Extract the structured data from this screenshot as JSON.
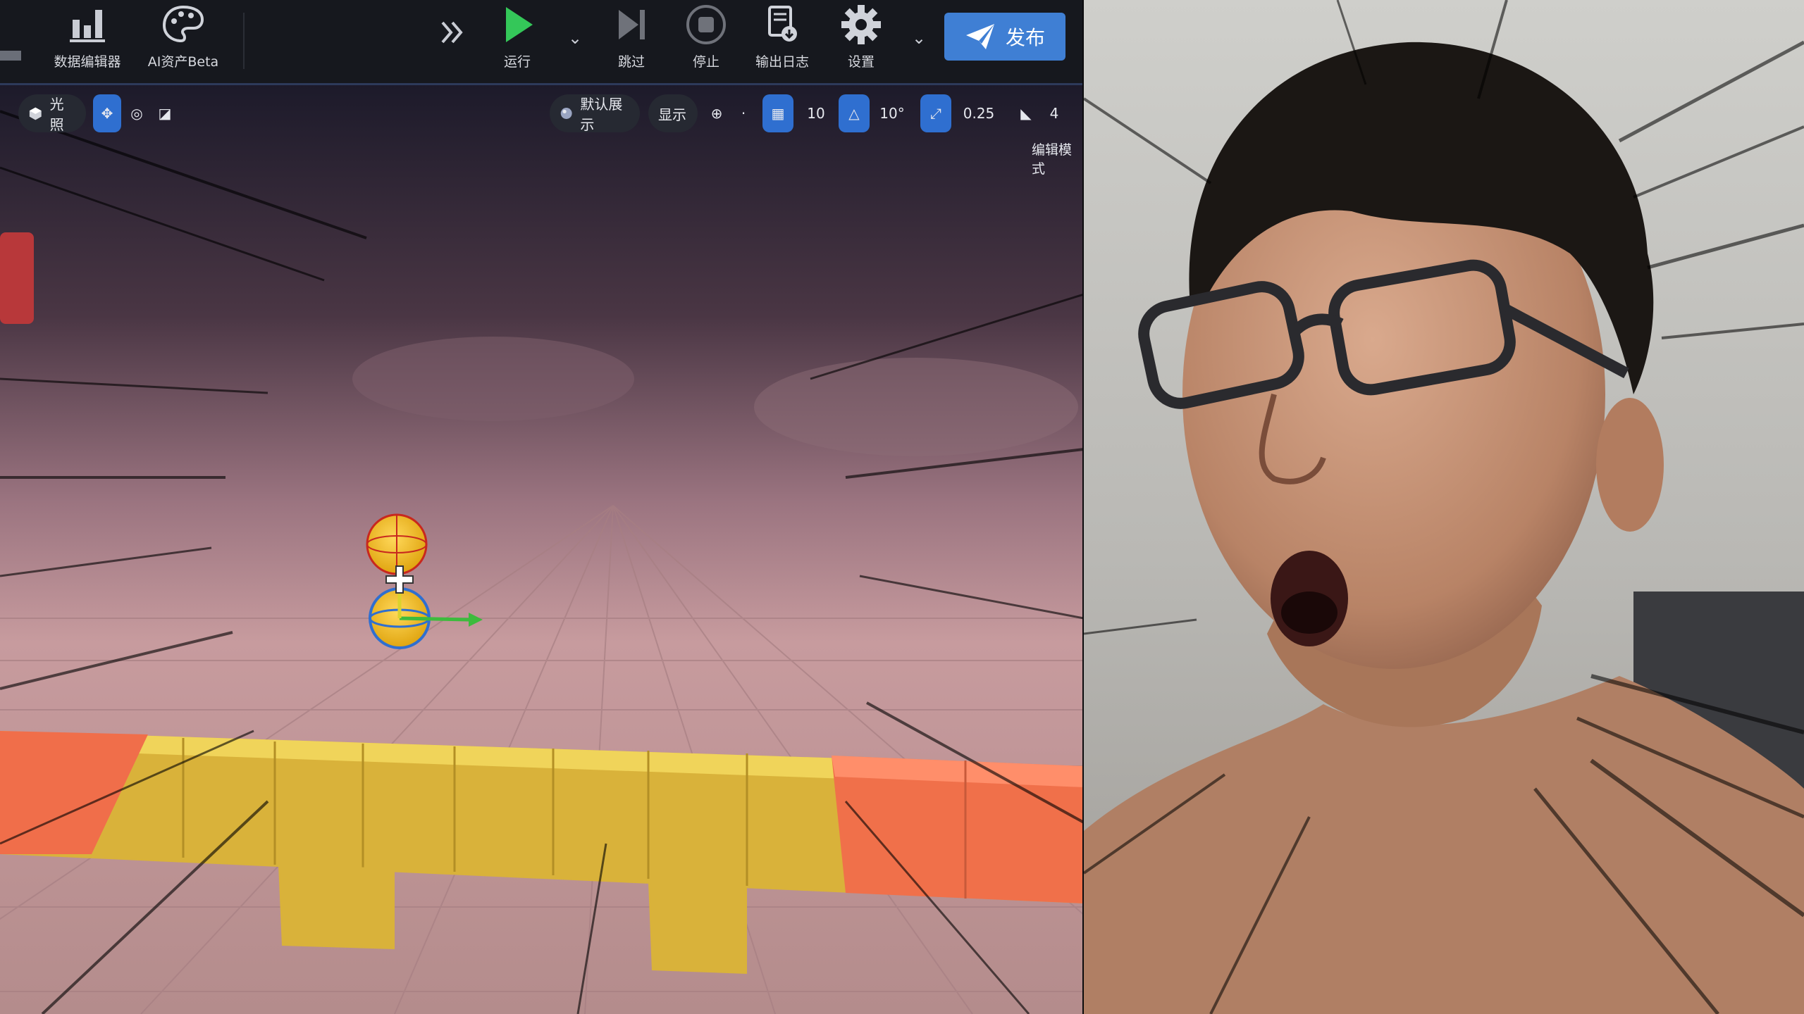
{
  "toolbar": {
    "data_editor_label": "数据编辑器",
    "ai_assets_label": "AI资产Beta",
    "run_label": "运行",
    "skip_label": "跳过",
    "stop_label": "停止",
    "log_label": "输出日志",
    "settings_label": "设置",
    "publish_label": "发布"
  },
  "viewport_toolbar": {
    "lighting_label": "光照",
    "default_view_label": "默认展示",
    "display_label": "显示",
    "grid_snap_value": "10",
    "rotate_snap_value": "10°",
    "scale_snap_value": "0.25",
    "camera_speed_value": "4",
    "mode_label": "编辑模式"
  },
  "colors": {
    "accent_blue": "#2f6fd0",
    "publish_blue": "#3f7fd4",
    "run_green": "#34c759",
    "block_yellow": "#e6c63c",
    "block_orange": "#f0704a",
    "sky_top": "#1e1b2c",
    "fog": "#c79b9e"
  }
}
